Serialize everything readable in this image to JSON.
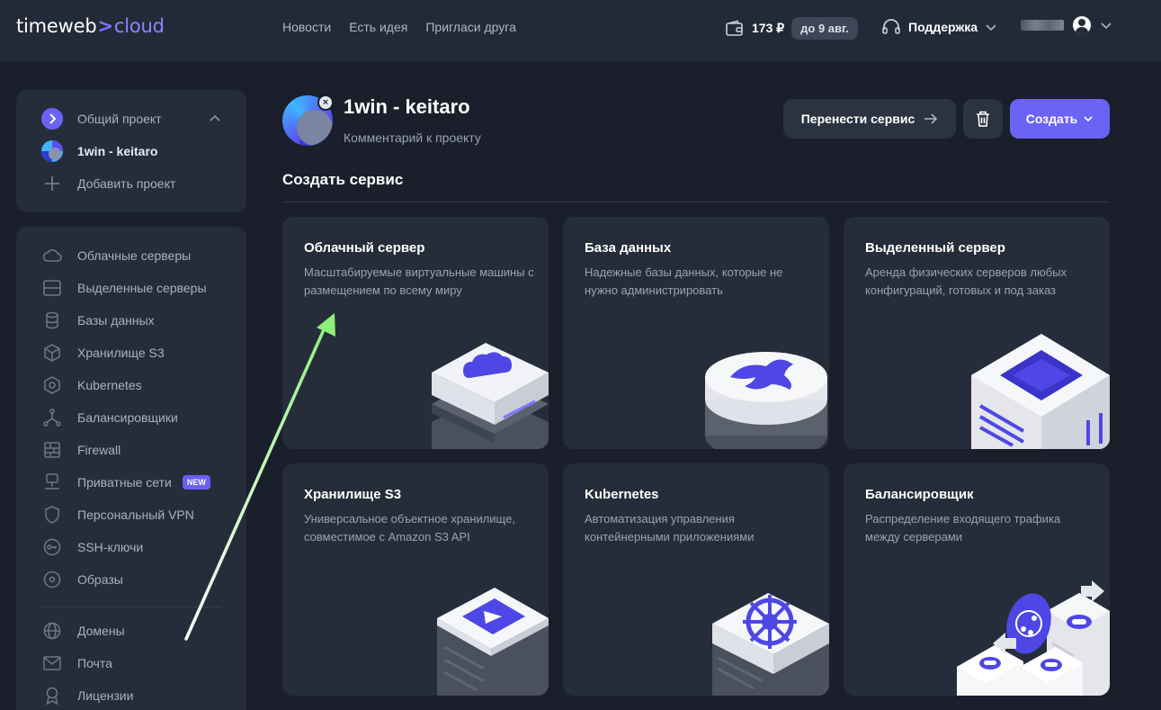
{
  "header": {
    "logo_main": "timeweb",
    "logo_sep": ">",
    "logo_accent": "cloud",
    "nav": [
      "Новости",
      "Есть идея",
      "Пригласи друга"
    ],
    "balance": "173 ₽",
    "balance_until": "до 9 авг.",
    "support": "Поддержка"
  },
  "projects": {
    "common": "Общий проект",
    "current": "1win - keitaro",
    "add": "Добавить проект"
  },
  "menu": {
    "items": [
      {
        "label": "Облачные серверы"
      },
      {
        "label": "Выделенные серверы"
      },
      {
        "label": "Базы данных"
      },
      {
        "label": "Хранилище S3"
      },
      {
        "label": "Kubernetes"
      },
      {
        "label": "Балансировщики"
      },
      {
        "label": "Firewall"
      },
      {
        "label": "Приватные сети",
        "badge": "NEW"
      },
      {
        "label": "Персональный VPN"
      },
      {
        "label": "SSH-ключи"
      },
      {
        "label": "Образы"
      },
      {
        "label": "Домены"
      },
      {
        "label": "Почта"
      },
      {
        "label": "Лицензии"
      }
    ]
  },
  "main": {
    "project_title": "1win - keitaro",
    "project_comment": "Комментарий к проекту",
    "move_button": "Перенести сервис",
    "create_button": "Создать",
    "section_title": "Создать сервис",
    "cards": [
      {
        "title": "Облачный сервер",
        "desc": "Масштабируемые виртуальные машины с размещением по всему миру"
      },
      {
        "title": "База данных",
        "desc": "Надежные базы данных, которые не нужно администрировать"
      },
      {
        "title": "Выделенный сервер",
        "desc": "Аренда физических серверов любых конфигураций, готовых и под заказ"
      },
      {
        "title": "Хранилище S3",
        "desc": "Универсальное объектное хранилище, совместимое с Amazon S3 API"
      },
      {
        "title": "Kubernetes",
        "desc": "Автоматизация управления контейнерными приложениями"
      },
      {
        "title": "Балансировщик",
        "desc": "Распределение входящего трафика между серверами"
      }
    ]
  },
  "colors": {
    "accent": "#6b63f6",
    "background": "#1a1f2b",
    "panel": "#262d3a",
    "annotation_arrow": "#8df07a"
  }
}
